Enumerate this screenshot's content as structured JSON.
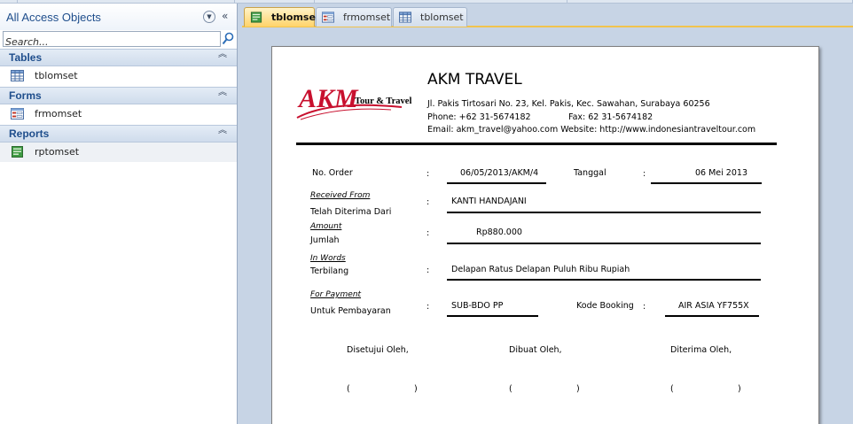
{
  "nav": {
    "title": "All Access Objects",
    "search_placeholder": "Search...",
    "groups": [
      {
        "label": "Tables",
        "items": [
          {
            "label": "tblomset"
          }
        ]
      },
      {
        "label": "Forms",
        "items": [
          {
            "label": "frmomset"
          }
        ]
      },
      {
        "label": "Reports",
        "items": [
          {
            "label": "rptomset"
          }
        ]
      }
    ]
  },
  "tabs": [
    {
      "label": "tblomset",
      "icon": "report-icon",
      "active": true
    },
    {
      "label": "frmomset",
      "icon": "form-icon",
      "active": false
    },
    {
      "label": "tblomset",
      "icon": "table-icon",
      "active": false
    }
  ],
  "report": {
    "logo": {
      "brand": "AKM",
      "tagline": "Tour & Travel"
    },
    "company": "AKM TRAVEL",
    "address": "Jl. Pakis Tirtosari No. 23, Kel. Pakis, Kec. Sawahan, Surabaya 60256",
    "phone": "Phone: +62 31-5674182",
    "fax": "Fax: 62 31-5674182",
    "email_line": "Email: akm_travel@yahoo.com Website: http://www.indonesiantraveltour.com",
    "no_order_label": "No. Order",
    "no_order_value": "06/05/2013/AKM/4",
    "tanggal_label": "Tanggal",
    "tanggal_value": "06 Mei 2013",
    "received_en": "Received From",
    "received_id": "Telah Diterima Dari",
    "received_value": "KANTI HANDAJANI",
    "amount_en": "Amount",
    "amount_id": "Jumlah",
    "amount_value": "Rp880.000",
    "words_en": "In Words",
    "words_id": "Terbilang",
    "words_value": "Delapan Ratus Delapan Puluh Ribu Rupiah",
    "payment_en": "For Payment",
    "payment_id": "Untuk Pembayaran",
    "payment_value": "SUB-BDO PP",
    "kode_label": "Kode Booking",
    "kode_value": "AIR ASIA YF755X",
    "colon": ":",
    "sign": {
      "approved": "Disetujui Oleh,",
      "made": "Dibuat Oleh,",
      "received": "Diterima Oleh,",
      "open": "(",
      "close": ")"
    }
  },
  "colors": {
    "accent": "#1f4e8c",
    "active_tab": "#ffd36a",
    "logo_red": "#c8102e"
  }
}
